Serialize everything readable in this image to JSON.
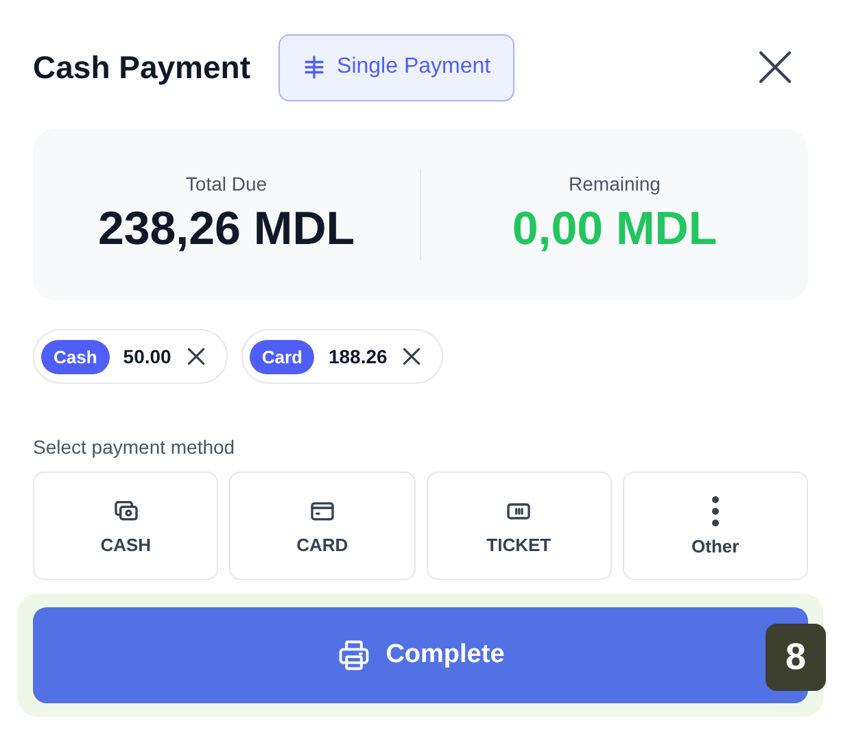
{
  "header": {
    "title": "Cash Payment",
    "mode_button": "Single Payment"
  },
  "summary": [
    {
      "label": "Total Due",
      "value": "238,26 MDL",
      "kind": "due"
    },
    {
      "label": "Remaining",
      "value": "0,00 MDL",
      "kind": "remaining"
    }
  ],
  "payments": [
    {
      "method": "Cash",
      "amount": "50.00"
    },
    {
      "method": "Card",
      "amount": "188.26"
    }
  ],
  "method_label": "Select payment method",
  "methods": [
    {
      "label": "CASH",
      "kind": "cash"
    },
    {
      "label": "CARD",
      "kind": "card"
    },
    {
      "label": "TICKET",
      "kind": "ticket"
    },
    {
      "label": "Other",
      "kind": "other"
    }
  ],
  "complete_button": {
    "label": "Complete",
    "shortcut": "8"
  }
}
